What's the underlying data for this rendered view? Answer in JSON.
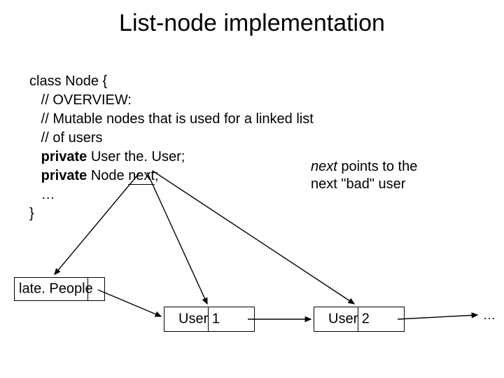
{
  "title": "List-node implementation",
  "code": {
    "line1": "class Node {",
    "line2": "   // OVERVIEW:",
    "line3": "   // Mutable nodes that is used for a linked list",
    "line4": "   // of users",
    "line5a": "   private ",
    "line5b": "User the. User;",
    "line6a": "   private ",
    "line6b": "Node ",
    "line6_next": "next",
    "line6c": ";",
    "line7": "   …",
    "line8": "}"
  },
  "annotation": {
    "italic_word": "next",
    "rest1": " points to the",
    "line2": "next \"bad\" user"
  },
  "boxes": {
    "late_people": "late. People",
    "user1": "User 1",
    "user2": "User 2"
  },
  "ellipsis": "…"
}
